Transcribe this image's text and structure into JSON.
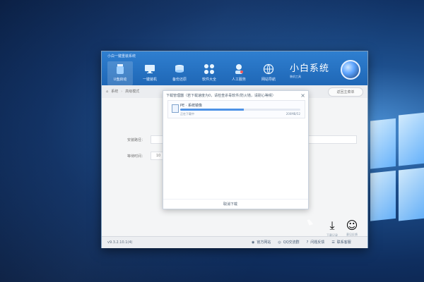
{
  "window": {
    "title": "小白一键重装系统"
  },
  "nav": [
    {
      "label": "U盘启动",
      "icon": "usb-drive-icon"
    },
    {
      "label": "一键装机",
      "icon": "computer-icon"
    },
    {
      "label": "备份还原",
      "icon": "database-icon"
    },
    {
      "label": "软件大全",
      "icon": "apps-icon"
    },
    {
      "label": "人工服务",
      "icon": "support-person-icon"
    },
    {
      "label": "网站导航",
      "icon": "globe-icon"
    }
  ],
  "brand": {
    "name": "小白系统",
    "subtitle": "装机工具"
  },
  "toolbar": {
    "crumbs": [
      "系统",
      "高级模式"
    ],
    "button_label": "返回主菜单"
  },
  "form": {
    "label_1": "安装路径：",
    "label_2": "等待时间：",
    "value_2": "10"
  },
  "dialog": {
    "title": "下载管理器（若下载速度为0，请检查杀毒软件/防火墙，请耐心等候）",
    "item_name": "PE · 系统镜像",
    "item_status": "正在下载中",
    "item_size": "200MB/52",
    "progress": 0.53,
    "cancel_label": "取消下载"
  },
  "bottom": {
    "version": "v9.3.2.10.1(4)",
    "links": [
      "官方网站",
      "QQ交流群",
      "问题反馈",
      "联系客服"
    ]
  },
  "side_actions": [
    {
      "label": "下载记录",
      "icon": "download-icon"
    },
    {
      "label": "意见反馈",
      "icon": "feedback-icon"
    }
  ]
}
